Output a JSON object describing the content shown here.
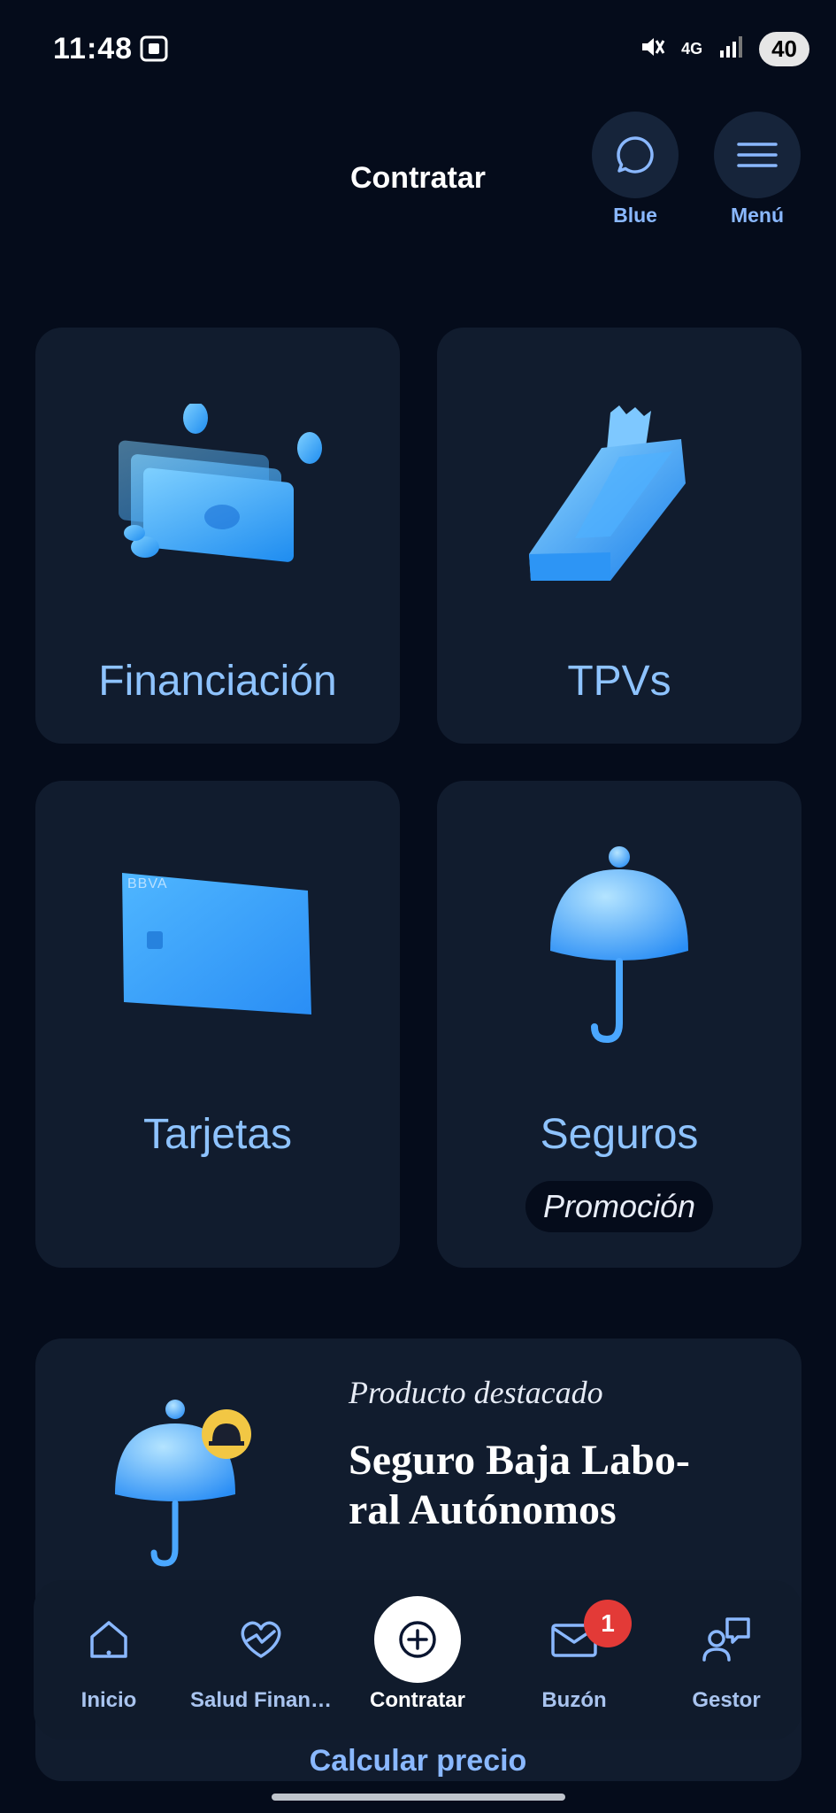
{
  "status": {
    "time": "11:48",
    "network": "4G",
    "battery": "40"
  },
  "header": {
    "title": "Contratar",
    "blue_label": "Blue",
    "menu_label": "Menú"
  },
  "cards": [
    {
      "label": "Financiación",
      "icon": "money-bills-icon"
    },
    {
      "label": "TPVs",
      "icon": "pos-terminal-icon"
    },
    {
      "label": "Tarjetas",
      "icon": "credit-card-icon",
      "card_brand": "BBVA"
    },
    {
      "label": "Seguros",
      "icon": "umbrella-icon",
      "badge": "Promoción"
    }
  ],
  "featured": {
    "eyebrow": "Producto destacado",
    "title": "Seguro Baja Labo-ral Autónomos",
    "title_line1": "Seguro Baja Labo-",
    "title_line2": "ral Autónomos",
    "cta": "Calcular precio"
  },
  "nav": {
    "items": [
      {
        "label": "Inicio",
        "icon": "home-icon"
      },
      {
        "label": "Salud Finan…",
        "icon": "heart-chart-icon"
      },
      {
        "label": "Contratar",
        "icon": "plus-circle-icon",
        "active": true
      },
      {
        "label": "Buzón",
        "icon": "mail-icon",
        "badge": "1"
      },
      {
        "label": "Gestor",
        "icon": "advisor-icon"
      }
    ]
  },
  "colors": {
    "background": "#050c1b",
    "card": "#111c2e",
    "accent": "#8ec3ff",
    "badge": "#e33a37"
  }
}
